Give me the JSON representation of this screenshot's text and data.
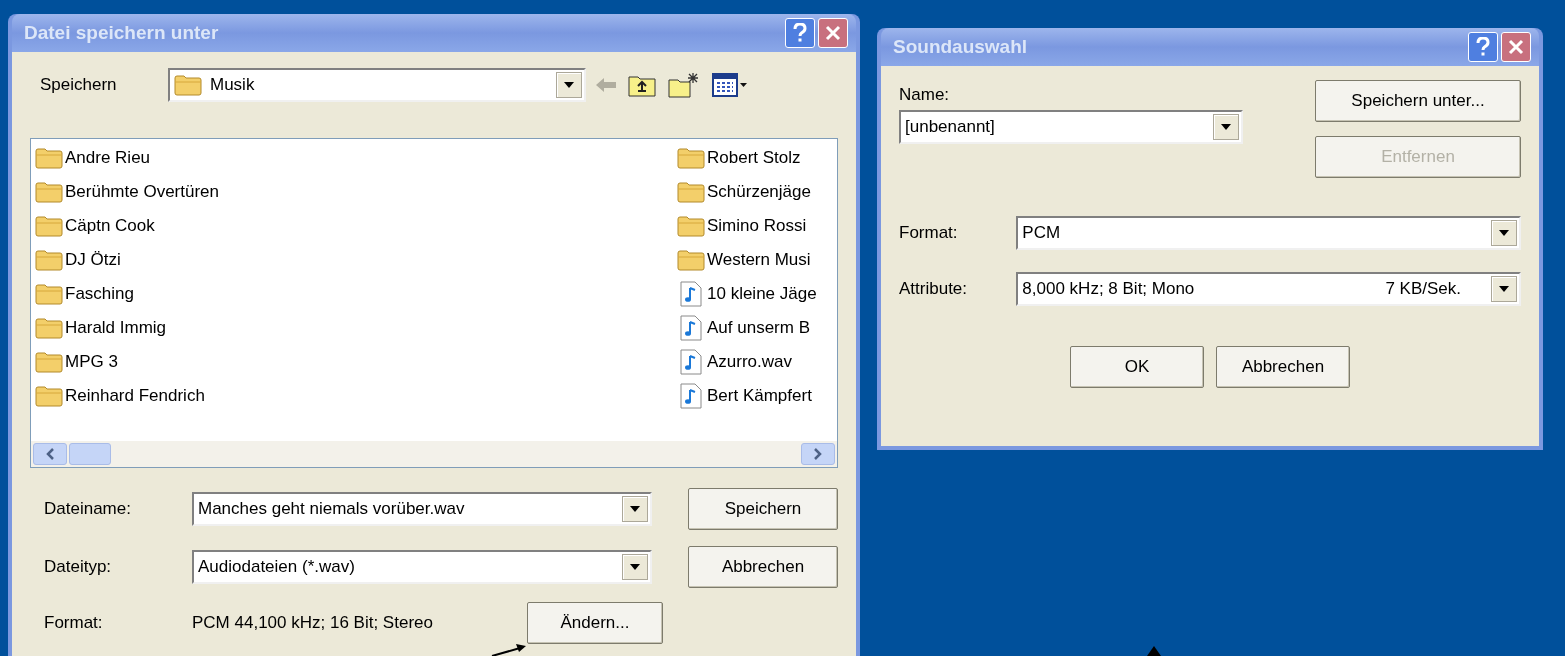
{
  "save_dialog": {
    "title": "Datei speichern unter",
    "location_label": "Speichern",
    "location": "Musik",
    "files": [
      {
        "name": "Andre Rieu",
        "kind": "folder"
      },
      {
        "name": "Berühmte Overtüren",
        "kind": "folder"
      },
      {
        "name": "Cäptn Cook",
        "kind": "folder"
      },
      {
        "name": "DJ Ötzi",
        "kind": "folder"
      },
      {
        "name": "Fasching",
        "kind": "folder"
      },
      {
        "name": "Harald Immig",
        "kind": "folder"
      },
      {
        "name": "MPG 3",
        "kind": "folder"
      },
      {
        "name": "Reinhard Fendrich",
        "kind": "folder"
      },
      {
        "name": "Robert Stolz",
        "kind": "folder"
      },
      {
        "name": "Schürzenjäge",
        "kind": "folder"
      },
      {
        "name": "Simino Rossi",
        "kind": "folder"
      },
      {
        "name": "Western Musi",
        "kind": "folder"
      },
      {
        "name": "10 kleine Jäge",
        "kind": "audio"
      },
      {
        "name": "Auf unserm B",
        "kind": "audio"
      },
      {
        "name": "Azurro.wav",
        "kind": "audio"
      },
      {
        "name": "Bert Kämpfert",
        "kind": "audio"
      }
    ],
    "filename_label": "Dateiname:",
    "filename": "Manches geht niemals vorüber.wav",
    "filetype_label": "Dateityp:",
    "filetype": "Audiodateien (*.wav)",
    "format_label": "Format:",
    "format": "PCM 44,100 kHz; 16 Bit; Stereo",
    "buttons": [
      {
        "label": "Speichern",
        "disabled": false
      },
      {
        "label": "Abbrechen",
        "disabled": false
      }
    ],
    "change_button": "Ändern..."
  },
  "sound_dialog": {
    "title": "Soundauswahl",
    "name_label": "Name:",
    "name": "[unbenannt]",
    "side_buttons": [
      {
        "label": "Speichern unter...",
        "disabled": false
      },
      {
        "label": "Entfernen",
        "disabled": true
      }
    ],
    "format_label": "Format:",
    "format": "PCM",
    "attribute_label": "Attribute:",
    "attribute": "8,000 kHz; 8 Bit; Mono",
    "attribute_rate": "7 KB/Sek.",
    "buttons": [
      {
        "label": "OK",
        "disabled": false
      },
      {
        "label": "Abbrechen",
        "disabled": false
      }
    ]
  }
}
